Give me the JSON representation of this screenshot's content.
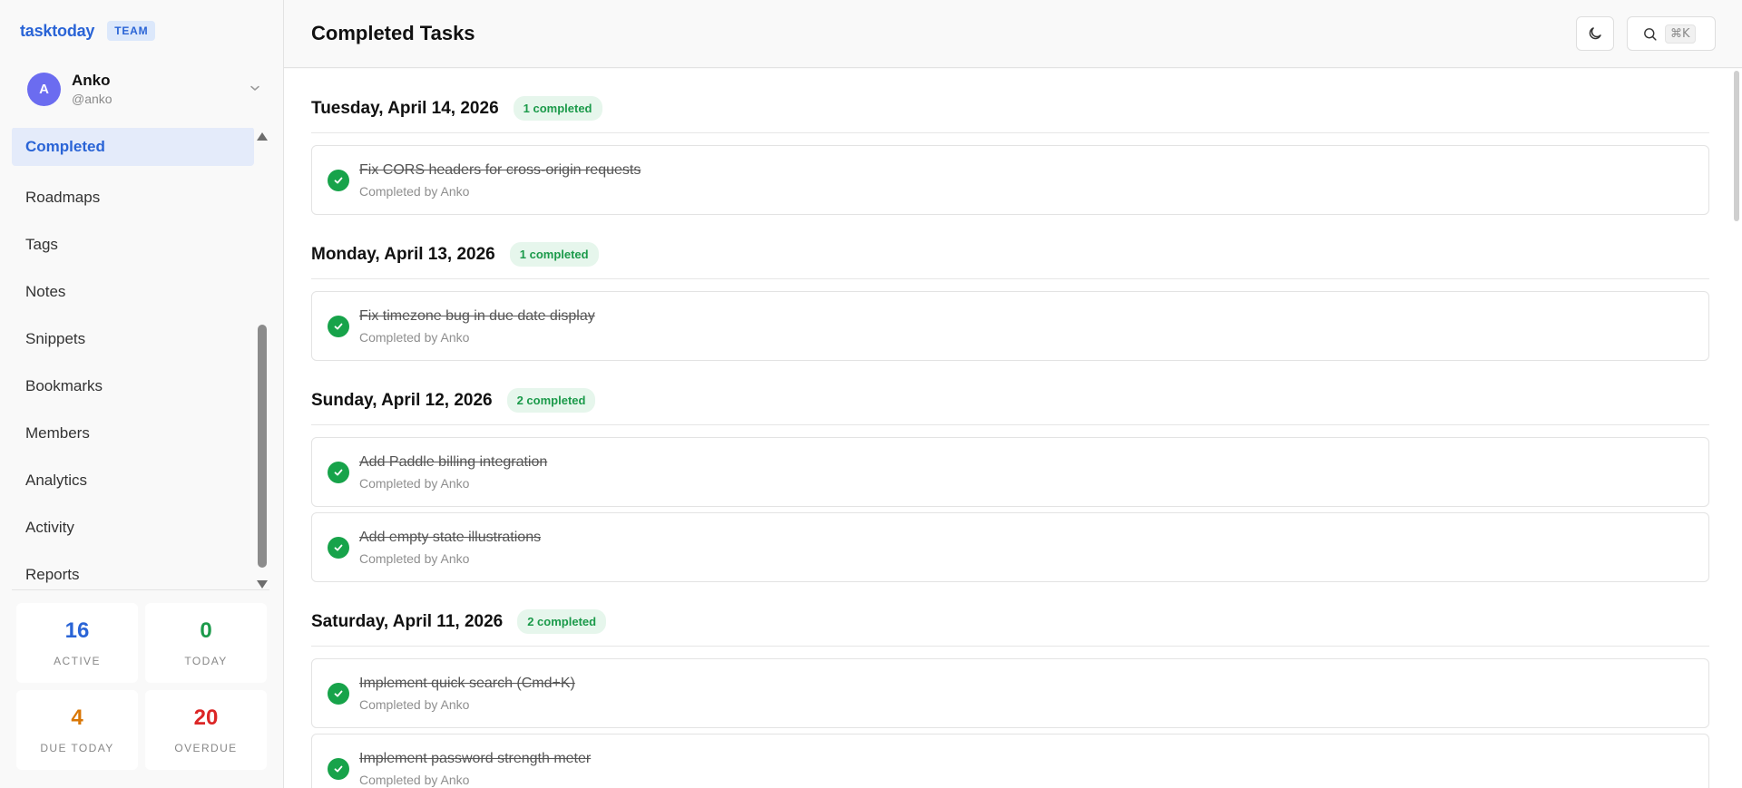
{
  "brand": {
    "name": "tasktoday",
    "badge": "TEAM"
  },
  "user": {
    "initial": "A",
    "name": "Anko",
    "handle": "@anko"
  },
  "nav": {
    "items": [
      {
        "label": "Completed",
        "active": true
      },
      {
        "label": "Roadmaps"
      },
      {
        "label": "Tags"
      },
      {
        "label": "Notes"
      },
      {
        "label": "Snippets"
      },
      {
        "label": "Bookmarks"
      },
      {
        "label": "Members"
      },
      {
        "label": "Analytics"
      },
      {
        "label": "Activity"
      },
      {
        "label": "Reports"
      }
    ]
  },
  "stats": [
    {
      "value": "16",
      "label": "ACTIVE",
      "color": "#2a64d6"
    },
    {
      "value": "0",
      "label": "TODAY",
      "color": "#1b9a4a"
    },
    {
      "value": "4",
      "label": "DUE TODAY",
      "color": "#d97706"
    },
    {
      "value": "20",
      "label": "OVERDUE",
      "color": "#dc2626"
    }
  ],
  "header": {
    "title": "Completed Tasks",
    "shortcut": "⌘K"
  },
  "groups": [
    {
      "date": "Tuesday, April 14, 2026",
      "badge": "1 completed",
      "tasks": [
        {
          "title": "Fix CORS headers for cross-origin requests",
          "meta": "Completed by Anko"
        }
      ]
    },
    {
      "date": "Monday, April 13, 2026",
      "badge": "1 completed",
      "tasks": [
        {
          "title": "Fix timezone bug in due date display",
          "meta": "Completed by Anko"
        }
      ]
    },
    {
      "date": "Sunday, April 12, 2026",
      "badge": "2 completed",
      "tasks": [
        {
          "title": "Add Paddle billing integration",
          "meta": "Completed by Anko"
        },
        {
          "title": "Add empty state illustrations",
          "meta": "Completed by Anko"
        }
      ]
    },
    {
      "date": "Saturday, April 11, 2026",
      "badge": "2 completed",
      "tasks": [
        {
          "title": "Implement quick search (Cmd+K)",
          "meta": "Completed by Anko"
        },
        {
          "title": "Implement password strength meter",
          "meta": "Completed by Anko"
        }
      ]
    }
  ]
}
